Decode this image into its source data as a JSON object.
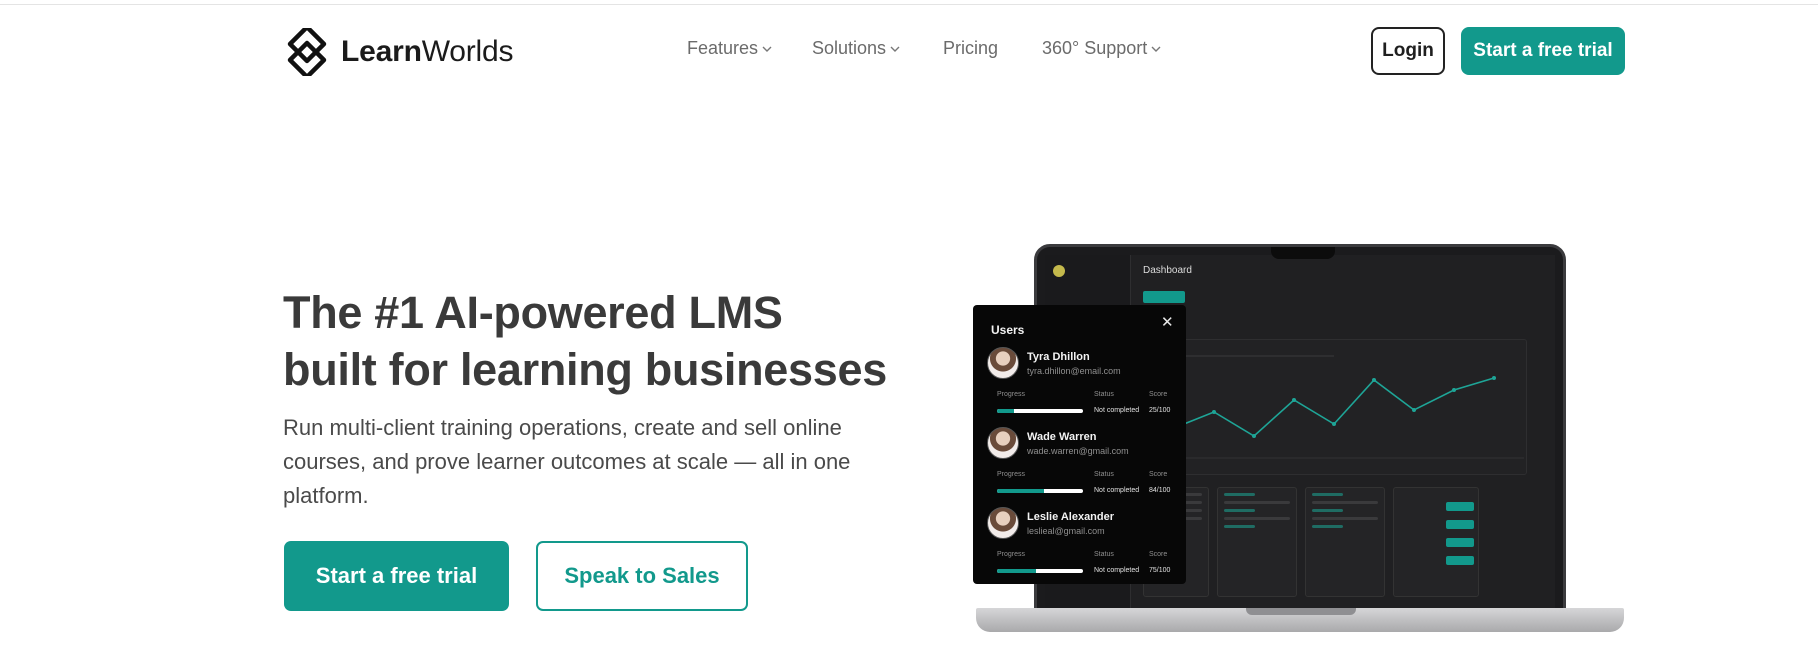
{
  "header": {
    "logo": {
      "bold": "Learn",
      "light": "Worlds"
    },
    "nav": [
      {
        "label": "Features",
        "dropdown": true
      },
      {
        "label": "Solutions",
        "dropdown": true
      },
      {
        "label": "Pricing",
        "dropdown": false
      },
      {
        "label": "360° Support",
        "dropdown": true
      }
    ],
    "login_label": "Login",
    "trial_label": "Start a free trial"
  },
  "hero": {
    "title_line1": "The #1 AI-powered LMS",
    "title_line2": "built for learning businesses",
    "subtitle": "Run multi-client training operations, create and sell online courses, and prove learner outcomes at scale — all in one platform.",
    "primary_cta": "Start a free trial",
    "secondary_cta": "Speak to Sales"
  },
  "colors": {
    "accent": "#12998c",
    "heading": "#3a3a3a",
    "nav_text": "#6b6b6b",
    "popup_bg": "#070707"
  },
  "dashboard_preview": {
    "title": "Dashboard",
    "users_panel": {
      "title": "Users",
      "columns": {
        "progress": "Progress",
        "status": "Status",
        "score": "Score"
      },
      "users": [
        {
          "name": "Tyra Dhillon",
          "email": "tyra.dhillon@email.com",
          "progress": 0.2,
          "status": "Not completed",
          "score": "25/100"
        },
        {
          "name": "Wade Warren",
          "email": "wade.warren@gmail.com",
          "progress": 0.55,
          "status": "Not completed",
          "score": "84/100"
        },
        {
          "name": "Leslie Alexander",
          "email": "leslieal@gmail.com",
          "progress": 0.45,
          "status": "Not completed",
          "score": "75/100"
        }
      ]
    }
  }
}
